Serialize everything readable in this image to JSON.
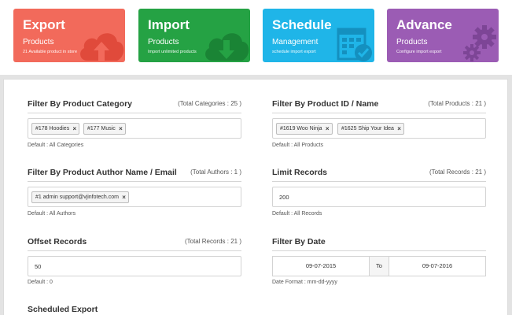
{
  "tiles": [
    {
      "title": "Export",
      "subtitle": "Products",
      "desc": "21 Available product in store",
      "color": "#f26a5b",
      "icon": "cloud-upload-icon"
    },
    {
      "title": "Import",
      "subtitle": "Products",
      "desc": "Import unlimited products",
      "color": "#25a244",
      "icon": "cloud-download-icon"
    },
    {
      "title": "Schedule",
      "subtitle": "Management",
      "desc": "schedule import export",
      "color": "#1fb5e8",
      "icon": "calendar-check-icon"
    },
    {
      "title": "Advance",
      "subtitle": "Products",
      "desc": "Configure import export",
      "color": "#9b5cb4",
      "icon": "gears-icon"
    }
  ],
  "filters": {
    "category": {
      "title": "Filter By Product Category",
      "count": "(Total Categories : 25 )",
      "tags": [
        "#178 Hoodies",
        "#177 Music"
      ],
      "help": "Default : All Categories"
    },
    "product_id": {
      "title": "Filter By Product ID / Name",
      "count": "(Total Products : 21 )",
      "tags": [
        "#1619 Woo Ninja",
        "#1625 Ship Your Idea"
      ],
      "help": "Default : All Products"
    },
    "author": {
      "title": "Filter By Product Author Name / Email",
      "count": "(Total Authors : 1 )",
      "tags": [
        "#1 admin support@vjinfotech.com"
      ],
      "help": "Default : All Authors"
    },
    "limit": {
      "title": "Limit Records",
      "count": "(Total Records : 21 )",
      "value": "200",
      "help": "Default : All Records"
    },
    "offset": {
      "title": "Offset Records",
      "count": "(Total Records : 21 )",
      "value": "50",
      "help": "Default : 0"
    },
    "date": {
      "title": "Filter By Date",
      "from": "09-07-2015",
      "to_label": "To",
      "to": "09-07-2016",
      "help": "Date Format : mm-dd-yyyy"
    },
    "scheduled": {
      "title": "Scheduled Export"
    }
  },
  "tag_remove_symbol": "×"
}
